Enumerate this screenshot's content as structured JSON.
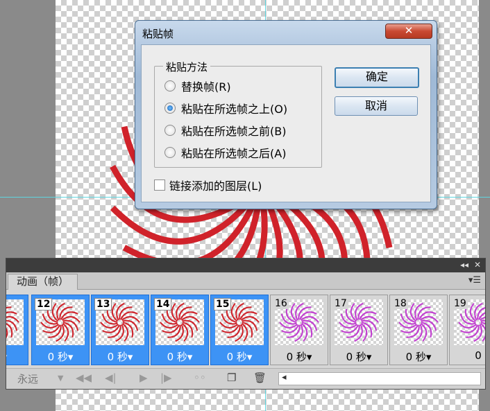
{
  "dialog": {
    "title": "粘贴帧",
    "close_label": "✕",
    "group_label": "粘贴方法",
    "options": [
      {
        "label": "替换帧(R)",
        "selected": false
      },
      {
        "label": "粘贴在所选帧之上(O)",
        "selected": true
      },
      {
        "label": "粘贴在所选帧之前(B)",
        "selected": false
      },
      {
        "label": "粘贴在所选帧之后(A)",
        "selected": false
      }
    ],
    "link_layers_label": "链接添加的图层(L)",
    "link_layers_checked": false,
    "ok_label": "确定",
    "cancel_label": "取消"
  },
  "panel": {
    "collapse_label": "◂◂",
    "close_label": "✕",
    "tab_label": "动画（帧）",
    "menu_icon": "panel-menu-icon",
    "frames": [
      {
        "number": "",
        "delay": "秒▾",
        "selected": true,
        "color": "#d0222a"
      },
      {
        "number": "12",
        "delay": "0 秒▾",
        "selected": true,
        "color": "#d0222a"
      },
      {
        "number": "13",
        "delay": "0 秒▾",
        "selected": true,
        "color": "#d0222a"
      },
      {
        "number": "14",
        "delay": "0 秒▾",
        "selected": true,
        "color": "#d0222a"
      },
      {
        "number": "15",
        "delay": "0 秒▾",
        "selected": true,
        "color": "#d0222a"
      },
      {
        "number": "16",
        "delay": "0 秒▾",
        "selected": false,
        "color": "#c23cd1"
      },
      {
        "number": "17",
        "delay": "0 秒▾",
        "selected": false,
        "color": "#c23cd1"
      },
      {
        "number": "18",
        "delay": "0 秒▾",
        "selected": false,
        "color": "#c23cd1"
      },
      {
        "number": "19",
        "delay": "0",
        "selected": false,
        "color": "#c23cd1"
      }
    ],
    "loop_label": "永远",
    "loop_dropdown": "▼",
    "btn_first": "◀◀",
    "btn_prev": "◀|",
    "btn_play": "▶",
    "btn_next": "|▶",
    "btn_tween": "◦◦",
    "btn_new": "❐",
    "btn_delete": "🗑",
    "scroll_left": "◂"
  },
  "colors": {
    "accent": "#3d93f5",
    "art": "#d0222a",
    "art_alt": "#c23cd1"
  }
}
